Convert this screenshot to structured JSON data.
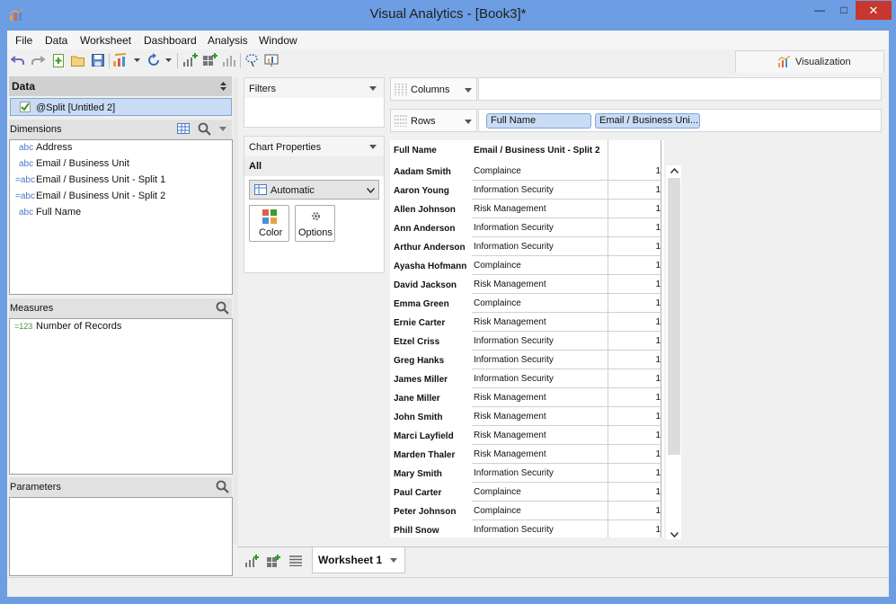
{
  "window": {
    "title": "Visual Analytics - [Book3]*",
    "min": "—",
    "max": "□",
    "close": "✕"
  },
  "menu": [
    "File",
    "Data",
    "Worksheet",
    "Dashboard",
    "Analysis",
    "Window"
  ],
  "viz_tab": {
    "label": "Visualization"
  },
  "data_panel": {
    "title": "Data",
    "source": "@Split [Untitled 2]",
    "dimensions_title": "Dimensions",
    "dimensions": [
      {
        "type": "abc",
        "label": "Address"
      },
      {
        "type": "abc",
        "label": "Email / Business Unit"
      },
      {
        "type": "=abc",
        "label": "Email / Business Unit - Split 1"
      },
      {
        "type": "=abc",
        "label": "Email / Business Unit - Split 2"
      },
      {
        "type": "abc",
        "label": "Full Name"
      }
    ],
    "measures_title": "Measures",
    "measures": [
      {
        "type": "=123",
        "label": "Number of Records"
      }
    ],
    "parameters_title": "Parameters"
  },
  "filters": {
    "title": "Filters"
  },
  "chart_properties": {
    "title": "Chart Properties",
    "scope": "All",
    "chart_type": "Automatic",
    "color_label": "Color",
    "options_label": "Options"
  },
  "shelves": {
    "columns_label": "Columns",
    "rows_label": "Rows",
    "row_pills": [
      "Full Name",
      "Email / Business Uni..."
    ]
  },
  "table": {
    "headers": [
      "Full Name",
      "Email / Business Unit - Split 2"
    ],
    "rows": [
      [
        "Aadam Smith",
        "Complaince",
        "1"
      ],
      [
        "Aaron Young",
        "Information Security",
        "1"
      ],
      [
        "Allen Johnson",
        "Risk Management",
        "1"
      ],
      [
        "Ann Anderson",
        "Information Security",
        "1"
      ],
      [
        "Arthur Anderson",
        "Information Security",
        "1"
      ],
      [
        "Ayasha Hofmann",
        "Complaince",
        "1"
      ],
      [
        "David Jackson",
        "Risk Management",
        "1"
      ],
      [
        "Emma Green",
        "Complaince",
        "1"
      ],
      [
        "Ernie Carter",
        "Risk Management",
        "1"
      ],
      [
        "Etzel Criss",
        "Information Security",
        "1"
      ],
      [
        "Greg Hanks",
        "Information Security",
        "1"
      ],
      [
        "James Miller",
        "Information Security",
        "1"
      ],
      [
        "Jane Miller",
        "Risk Management",
        "1"
      ],
      [
        "John Smith",
        "Risk Management",
        "1"
      ],
      [
        "Marci Layfield",
        "Risk Management",
        "1"
      ],
      [
        "Marden Thaler",
        "Risk Management",
        "1"
      ],
      [
        "Mary Smith",
        "Information Security",
        "1"
      ],
      [
        "Paul Carter",
        "Complaince",
        "1"
      ],
      [
        "Peter Johnson",
        "Complaince",
        "1"
      ],
      [
        "Phill Snow",
        "Information Security",
        "1"
      ]
    ]
  },
  "sheet_tabs": {
    "active": "Worksheet 1"
  },
  "colors": {
    "accent": "#c9dcf4",
    "titlebar": "#6d9de2",
    "close": "#c7372f"
  }
}
